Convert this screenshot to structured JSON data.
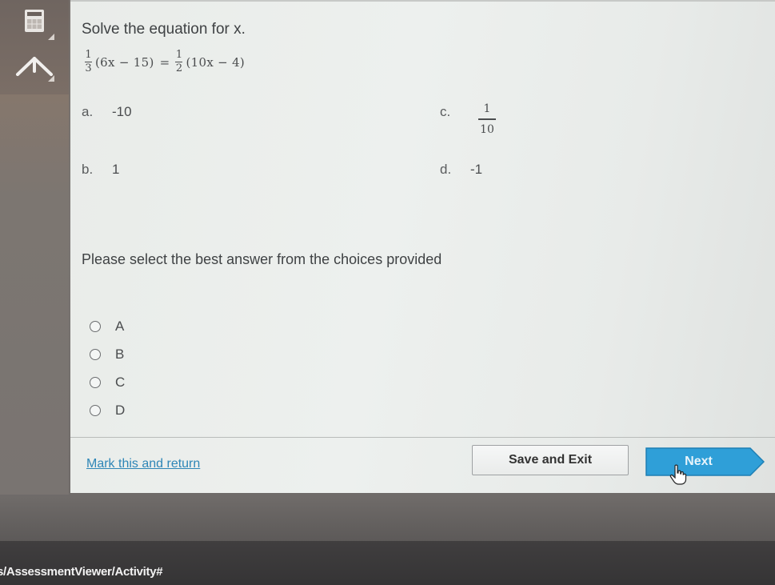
{
  "sidebar": {
    "tools": [
      {
        "name": "calculator",
        "icon": "calculator-icon"
      },
      {
        "name": "collapse",
        "icon": "chevron-up-icon"
      }
    ]
  },
  "question": {
    "title": "Solve the equation for x.",
    "equation": {
      "left_fraction": {
        "numerator": "1",
        "denominator": "3"
      },
      "left_expr": "(6x − 15)",
      "equals": "=",
      "right_fraction": {
        "numerator": "1",
        "denominator": "2"
      },
      "right_expr": "(10x − 4)"
    },
    "choices": [
      {
        "letter": "a.",
        "value": "-10"
      },
      {
        "letter": "b.",
        "value": "1"
      },
      {
        "letter": "c.",
        "numerator": "1",
        "denominator": "10"
      },
      {
        "letter": "d.",
        "value": "-1"
      }
    ]
  },
  "answer": {
    "instruction": "Please select the best answer from the choices provided",
    "options": [
      {
        "label": "A",
        "selected": false
      },
      {
        "label": "B",
        "selected": false
      },
      {
        "label": "C",
        "selected": false
      },
      {
        "label": "D",
        "selected": false
      }
    ]
  },
  "footer": {
    "mark_link": "Mark this and return",
    "save_label": "Save and Exit",
    "next_label": "Next",
    "accent_color": "#2f9fd8"
  },
  "status_bar": {
    "url_fragment": "s/AssessmentViewer/Activity#"
  }
}
